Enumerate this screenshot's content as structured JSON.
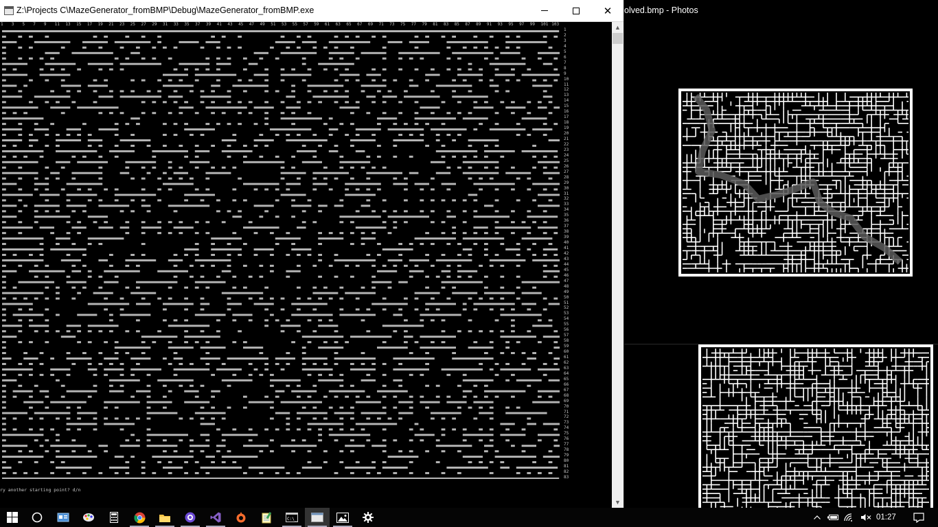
{
  "console": {
    "title": "Z:\\Projects C\\MazeGenerator_fromBMP\\Debug\\MazeGenerator_fromBMP.exe",
    "prompt": "ry another starting point? d/n",
    "column_numbers": [
      "1",
      "3",
      "5",
      "7",
      "9",
      "11",
      "13",
      "15",
      "17",
      "19",
      "21",
      "23",
      "25",
      "27",
      "29",
      "31",
      "33",
      "35",
      "37",
      "39",
      "41",
      "43",
      "45",
      "47",
      "49",
      "51",
      "53",
      "55",
      "57",
      "59",
      "61",
      "63",
      "65",
      "67",
      "69",
      "71",
      "73",
      "75",
      "77",
      "79",
      "81",
      "83",
      "85",
      "87",
      "89",
      "91",
      "93",
      "95",
      "97",
      "99",
      "101",
      "103"
    ],
    "row_count": 83,
    "colors": {
      "wall": "#b4b4b4",
      "path": "#e6e6e6",
      "text": "#c8c8c8",
      "background": "#000000"
    }
  },
  "photos": {
    "title": "olved.bmp - Photos",
    "colors": {
      "wall": "#ffffff",
      "solution": "#555555",
      "background": "#000000"
    }
  },
  "taskbar": {
    "items": [
      {
        "name": "start-button",
        "icon": "windows-logo-icon"
      },
      {
        "name": "cortana-button",
        "icon": "circle-search-icon"
      },
      {
        "name": "task-view-button",
        "icon": "id-card-icon"
      },
      {
        "name": "paint-button",
        "icon": "paint-palette-icon"
      },
      {
        "name": "calculator-button",
        "icon": "calculator-icon"
      },
      {
        "name": "chrome-button",
        "icon": "chrome-icon"
      },
      {
        "name": "file-explorer-button",
        "icon": "folder-icon"
      },
      {
        "name": "media-app-button",
        "icon": "record-icon"
      },
      {
        "name": "visual-studio-button",
        "icon": "visual-studio-icon"
      },
      {
        "name": "origin-button",
        "icon": "origin-icon"
      },
      {
        "name": "notepad-button",
        "icon": "notepad-icon"
      },
      {
        "name": "command-prompt-button",
        "icon": "cmd-icon"
      },
      {
        "name": "console-app-button",
        "icon": "window-icon"
      },
      {
        "name": "photos-button",
        "icon": "photo-icon"
      },
      {
        "name": "settings-button",
        "icon": "gear-icon"
      }
    ],
    "tray_icons": [
      "chevron-up-icon",
      "battery-icon",
      "wifi-icon",
      "volume-muted-icon"
    ],
    "clock": "01:27",
    "notification_icon": "notification-icon"
  }
}
